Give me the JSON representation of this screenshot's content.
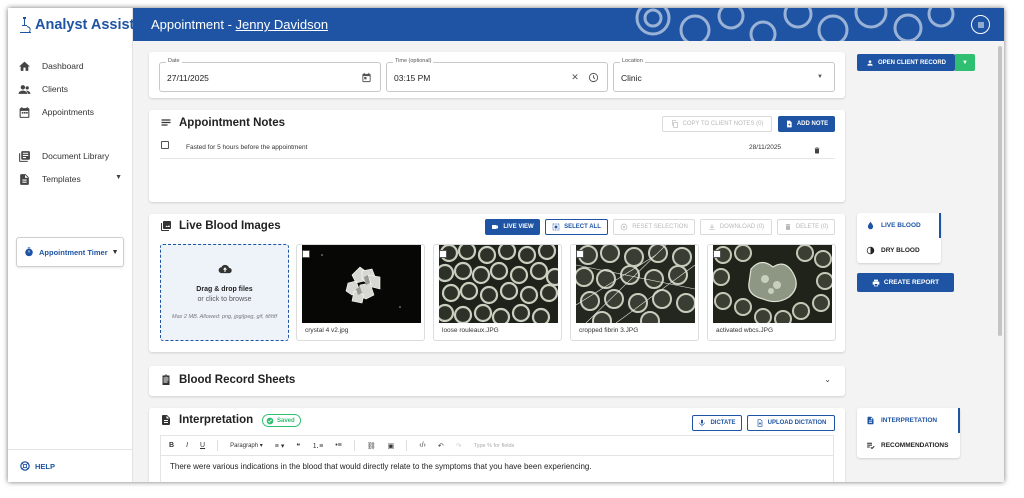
{
  "app": {
    "name": "Analyst Assist"
  },
  "sidebar": {
    "items": [
      {
        "label": "Dashboard"
      },
      {
        "label": "Clients"
      },
      {
        "label": "Appointments"
      },
      {
        "label": "Document Library"
      },
      {
        "label": "Templates"
      }
    ],
    "timer_label": "Appointment Timer",
    "help_label": "HELP"
  },
  "header": {
    "title_prefix": "Appointment - ",
    "client_name": "Jenny Davidson"
  },
  "details": {
    "date": {
      "label": "Date",
      "value": "27/11/2025"
    },
    "time": {
      "label": "Time (optional)",
      "value": "03:15 PM"
    },
    "location": {
      "label": "Location",
      "value": "Clinic"
    }
  },
  "client_record_button": "OPEN CLIENT RECORD",
  "notes": {
    "title": "Appointment Notes",
    "copy_button": "COPY TO CLIENT NOTES (0)",
    "add_button": "ADD NOTE",
    "rows": [
      {
        "text": "Fasted for 5 hours before the appointment",
        "date": "28/11/2025"
      }
    ]
  },
  "images": {
    "title": "Live Blood Images",
    "live_view": "LIVE VIEW",
    "select_all": "SELECT ALL",
    "reset_selection": "RESET SELECTION",
    "download": "DOWNLOAD (0)",
    "delete": "DELETE (0)",
    "upload": {
      "title": "Drag & drop files",
      "subtitle": "or click to browse",
      "note": "Max 2 MB. Allowed: png, jpg/jpeg, gif, tif/tiff"
    },
    "items": [
      {
        "caption": "crystal 4 v2.jpg"
      },
      {
        "caption": "loose rouleaux.JPG"
      },
      {
        "caption": "cropped fibrin 3.JPG"
      },
      {
        "caption": "activated wbcs.JPG"
      }
    ]
  },
  "blood_tabs": {
    "live": "LIVE BLOOD",
    "dry": "DRY BLOOD",
    "create_report": "CREATE REPORT"
  },
  "record_sheets": {
    "title": "Blood Record Sheets"
  },
  "interpretation": {
    "title": "Interpretation",
    "saved_badge": "Saved",
    "dictate": "DICTATE",
    "upload_dictation": "UPLOAD DICTATION",
    "toolbar": {
      "bold": "B",
      "italic": "I",
      "underline": "U",
      "paragraph": "Paragraph",
      "quote": "❝",
      "placeholder": "Type % for fields"
    },
    "text": "There were various indications in the blood that would directly relate to the symptoms that you have been experiencing."
  },
  "right_tabs": {
    "interpretation": "INTERPRETATION",
    "recommendations": "RECOMMENDATIONS"
  },
  "colors": {
    "brand": "#1e54a3",
    "green": "#2fbf71",
    "page_bg": "#f3f3f3"
  }
}
